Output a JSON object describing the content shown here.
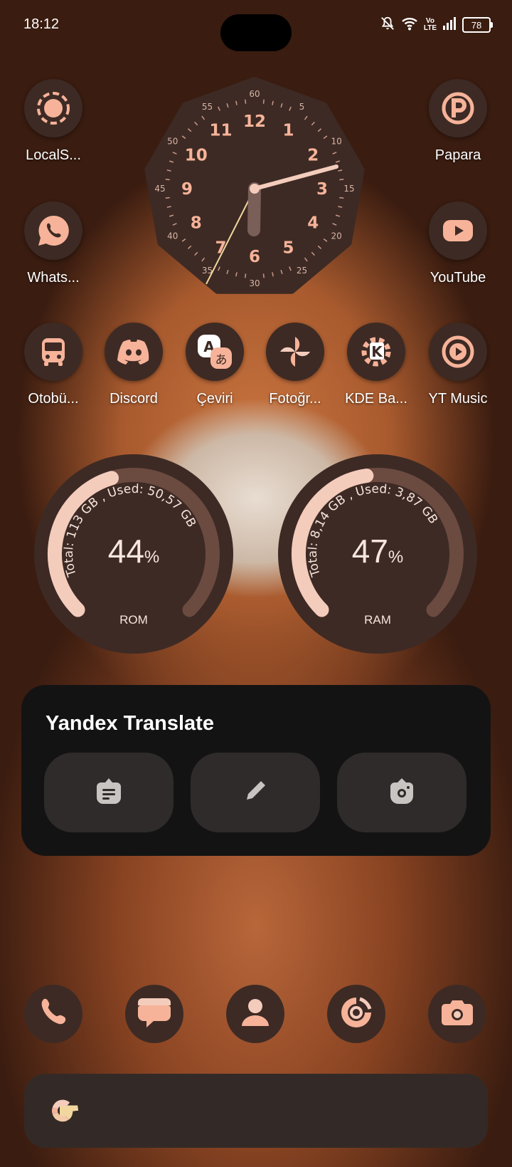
{
  "status_bar": {
    "time": "18:12",
    "network_top": "Vo",
    "network_bottom": "LTE",
    "battery": "78",
    "icons": [
      "bell-off-icon",
      "wifi-icon",
      "signal-icon",
      "battery-icon"
    ]
  },
  "clock": {
    "hour_numerals": [
      "12",
      "1",
      "2",
      "3",
      "4",
      "5",
      "6",
      "7",
      "8",
      "9",
      "10",
      "11"
    ],
    "minute_numerals": [
      "60",
      "5",
      "10",
      "15",
      "20",
      "25",
      "30",
      "35",
      "40",
      "45",
      "50",
      "55"
    ],
    "time": "18:12"
  },
  "apps_left": [
    {
      "label": "LocalS...",
      "icon": "localsend-icon"
    },
    {
      "label": "Whats...",
      "icon": "whatsapp-icon"
    }
  ],
  "apps_right": [
    {
      "label": "Papara",
      "icon": "papara-icon"
    },
    {
      "label": "YouTube",
      "icon": "youtube-icon"
    }
  ],
  "app_row": [
    {
      "label": "Otobü...",
      "icon": "bus-icon"
    },
    {
      "label": "Discord",
      "icon": "discord-icon"
    },
    {
      "label": "Çeviri",
      "icon": "translate-icon"
    },
    {
      "label": "Fotoğr...",
      "icon": "pinwheel-icon"
    },
    {
      "label": "KDE Ba...",
      "icon": "kde-icon"
    },
    {
      "label": "YT Music",
      "icon": "yt-music-icon"
    }
  ],
  "storage": {
    "rom": {
      "total": "Total: 113 GB ,",
      "used": "Used: 50,57 GB",
      "percent": "44",
      "percent_sign": "%",
      "caption": "ROM",
      "fraction": 0.44
    },
    "ram": {
      "total": "Total: 8,14 GB ,",
      "used": "Used: 3,87 GB",
      "percent": "47",
      "percent_sign": "%",
      "caption": "RAM",
      "fraction": 0.47
    }
  },
  "yandex": {
    "title": "Yandex Translate",
    "buttons": [
      "text-translate-icon",
      "handwriting-icon",
      "camera-translate-icon"
    ]
  },
  "dock": [
    "phone-icon",
    "messages-icon",
    "contacts-icon",
    "browser-icon",
    "camera-icon"
  ],
  "search": {
    "logo": "G"
  },
  "colors": {
    "accent": "#f6b399",
    "widget_bg": "#3d2a24",
    "gauge_track": "#6b4a40",
    "gauge_fill": "#f4ccbc"
  }
}
